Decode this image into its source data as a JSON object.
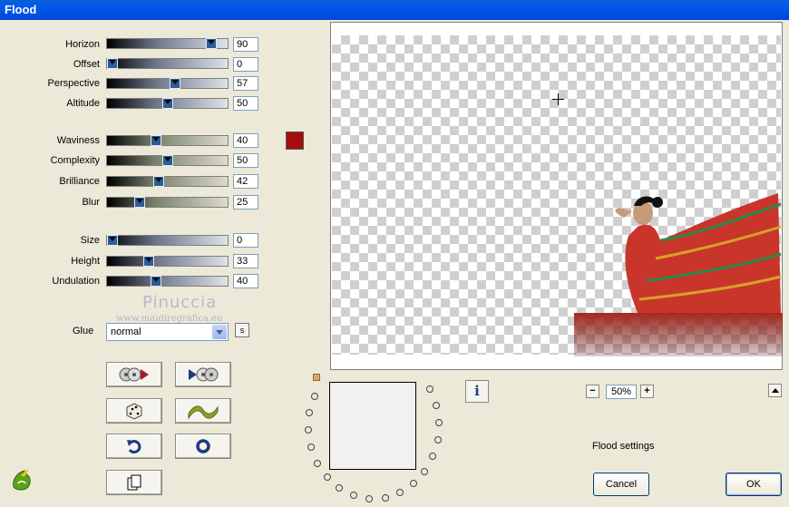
{
  "window": {
    "title": "Flood"
  },
  "sliders": [
    {
      "label": "Horizon",
      "value": "90",
      "level": 0.9,
      "style": "blue"
    },
    {
      "label": "Offset",
      "value": "0",
      "level": 0.0,
      "style": "blue"
    },
    {
      "label": "Perspective",
      "value": "57",
      "level": 0.57,
      "style": "blue"
    },
    {
      "label": "Altitude",
      "value": "50",
      "level": 0.5,
      "style": "blue"
    },
    {
      "label": "Waviness",
      "value": "40",
      "level": 0.4,
      "style": "green"
    },
    {
      "label": "Complexity",
      "value": "50",
      "level": 0.5,
      "style": "green"
    },
    {
      "label": "Brilliance",
      "value": "42",
      "level": 0.42,
      "style": "green"
    },
    {
      "label": "Blur",
      "value": "25",
      "level": 0.25,
      "style": "green"
    },
    {
      "label": "Size",
      "value": "0",
      "level": 0.0,
      "style": "blue"
    },
    {
      "label": "Height",
      "value": "33",
      "level": 0.33,
      "style": "blue"
    },
    {
      "label": "Undulation",
      "value": "40",
      "level": 0.4,
      "style": "blue"
    }
  ],
  "color_swatch": "#a80c0c",
  "watermark": {
    "name": "Pinuccia",
    "url": "www.maidiregrafica.eu"
  },
  "glue": {
    "label": "Glue",
    "value": "normal",
    "s_button": "s"
  },
  "preview": {
    "zoom": "50%"
  },
  "settings_label": "Flood settings",
  "buttons": {
    "cancel": "Cancel",
    "ok": "OK",
    "info": "i",
    "zoom_out": "−",
    "zoom_in": "+"
  }
}
